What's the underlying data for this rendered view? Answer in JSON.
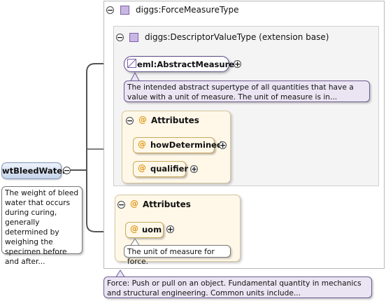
{
  "root_element": {
    "name": "wtBleedWater",
    "documentation": "The weight of bleed water that occurs during curing, generally determined by weighing the specimen before and after..."
  },
  "type": {
    "name": "diggs:ForceMeasureType",
    "documentation": "Force: Push or pull on an object. Fundamental quantity in mechanics and structural engineering. Common units include..."
  },
  "base_type": {
    "name": "diggs:DescriptorValueType (extension base)"
  },
  "abstract_element": {
    "name": "eml:AbstractMeasure",
    "documentation": "The intended abstract supertype of all quantities that have a value with a unit of measure. The unit of measure is in..."
  },
  "attribute_groups": [
    {
      "label": "Attributes",
      "attributes": [
        {
          "name": "howDetermined"
        },
        {
          "name": "qualifier"
        }
      ]
    },
    {
      "label": "Attributes",
      "attributes": [
        {
          "name": "uom",
          "documentation": "The unit of measure for force."
        }
      ]
    }
  ],
  "glyphs": {
    "collapse": "−",
    "expand": "+",
    "at": "@"
  },
  "colors": {
    "complex_type_icon": "#c9b6e3",
    "attribute_fill": "#fff8e9",
    "element_fill": "#c5d4ea"
  }
}
